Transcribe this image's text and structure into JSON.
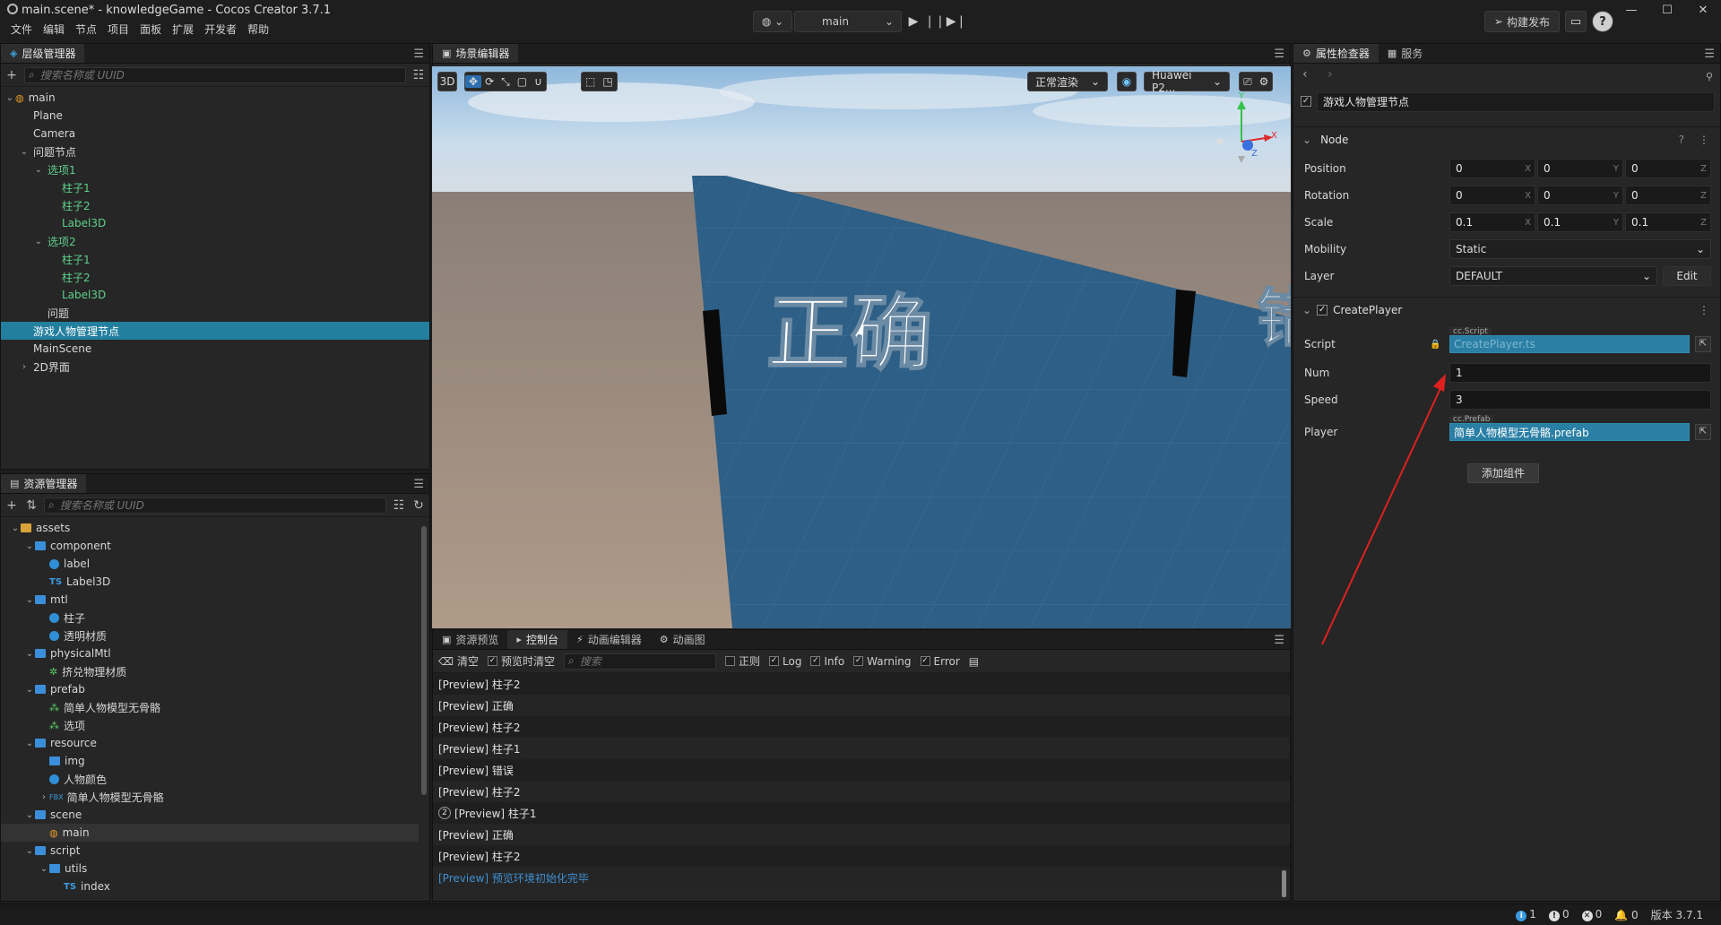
{
  "window": {
    "title": "main.scene* - knowledgeGame - Cocos Creator 3.7.1",
    "menu": [
      "文件",
      "编辑",
      "节点",
      "项目",
      "面板",
      "扩展",
      "开发者",
      "帮助"
    ],
    "scene_select": "main",
    "build_label": "构建发布",
    "help": "?"
  },
  "hierarchy": {
    "tab": "层级管理器",
    "search_placeholder": "搜索名称或 UUID",
    "nodes": [
      {
        "label": "main",
        "depth": 0,
        "arrow": "v",
        "icon": "scene"
      },
      {
        "label": "Plane",
        "depth": 1
      },
      {
        "label": "Camera",
        "depth": 1
      },
      {
        "label": "问题节点",
        "depth": 1,
        "arrow": "v"
      },
      {
        "label": "选项1",
        "depth": 2,
        "arrow": "v",
        "green": true
      },
      {
        "label": "柱子1",
        "depth": 3,
        "green": true
      },
      {
        "label": "柱子2",
        "depth": 3,
        "green": true
      },
      {
        "label": "Label3D",
        "depth": 3,
        "green": true
      },
      {
        "label": "选项2",
        "depth": 2,
        "arrow": "v",
        "green": true
      },
      {
        "label": "柱子1",
        "depth": 3,
        "green": true
      },
      {
        "label": "柱子2",
        "depth": 3,
        "green": true
      },
      {
        "label": "Label3D",
        "depth": 3,
        "green": true
      },
      {
        "label": "问题",
        "depth": 2
      },
      {
        "label": "游戏人物管理节点",
        "depth": 1,
        "selected": true
      },
      {
        "label": "MainScene",
        "depth": 1
      },
      {
        "label": "2D界面",
        "depth": 1,
        "arrow": ">"
      }
    ]
  },
  "assets": {
    "tab": "资源管理器",
    "search_placeholder": "搜索名称或 UUID",
    "items": [
      {
        "label": "assets",
        "depth": 0,
        "arrow": "v",
        "icon": "db"
      },
      {
        "label": "component",
        "depth": 1,
        "arrow": "v",
        "icon": "folder"
      },
      {
        "label": "label",
        "depth": 2,
        "icon": "globe"
      },
      {
        "label": "Label3D",
        "depth": 2,
        "icon": "ts"
      },
      {
        "label": "mtl",
        "depth": 1,
        "arrow": "v",
        "icon": "folder"
      },
      {
        "label": "柱子",
        "depth": 2,
        "icon": "globe"
      },
      {
        "label": "透明材质",
        "depth": 2,
        "icon": "globe"
      },
      {
        "label": "physicalMtl",
        "depth": 1,
        "arrow": "v",
        "icon": "folder"
      },
      {
        "label": "挤兑物理材质",
        "depth": 2,
        "icon": "physic"
      },
      {
        "label": "prefab",
        "depth": 1,
        "arrow": "v",
        "icon": "folder"
      },
      {
        "label": "简单人物模型无骨骼",
        "depth": 2,
        "icon": "prefab"
      },
      {
        "label": "选项",
        "depth": 2,
        "icon": "prefab"
      },
      {
        "label": "resource",
        "depth": 1,
        "arrow": "v",
        "icon": "folder"
      },
      {
        "label": "img",
        "depth": 2,
        "icon": "folder"
      },
      {
        "label": "人物颜色",
        "depth": 2,
        "icon": "globe"
      },
      {
        "label": "简单人物模型无骨骼",
        "depth": 2,
        "arrow": ">",
        "icon": "fbx"
      },
      {
        "label": "scene",
        "depth": 1,
        "arrow": "v",
        "icon": "folder"
      },
      {
        "label": "main",
        "depth": 2,
        "icon": "scene",
        "hl": true
      },
      {
        "label": "script",
        "depth": 1,
        "arrow": "v",
        "icon": "folder"
      },
      {
        "label": "utils",
        "depth": 2,
        "arrow": "v",
        "icon": "folder"
      },
      {
        "label": "index",
        "depth": 3,
        "icon": "ts"
      }
    ]
  },
  "scene_editor": {
    "tab": "场景编辑器",
    "mode_3d": "3D",
    "render_mode": "正常渲染",
    "device": "Huawei P2...",
    "text_correct": "正确",
    "text_partial": "错"
  },
  "console": {
    "tabs": [
      "资源预览",
      "控制台",
      "动画编辑器",
      "动画图"
    ],
    "active_tab": 1,
    "clear": "清空",
    "clear_on_preview": "预览时清空",
    "search_placeholder": "搜索",
    "regex": "正则",
    "filters": [
      "Log",
      "Info",
      "Warning",
      "Error"
    ],
    "logs": [
      {
        "text": "[Preview] 柱子2"
      },
      {
        "text": "[Preview] 正确"
      },
      {
        "text": "[Preview] 柱子2"
      },
      {
        "text": "[Preview] 柱子1"
      },
      {
        "text": "[Preview] 错误"
      },
      {
        "text": "[Preview] 柱子2"
      },
      {
        "text": "[Preview] 柱子1",
        "count": "2"
      },
      {
        "text": "[Preview] 正确"
      },
      {
        "text": "[Preview] 柱子2"
      },
      {
        "text": "[Preview] 预览环境初始化完毕",
        "info": true
      }
    ]
  },
  "inspector": {
    "tabs": [
      "属性检查器",
      "服务"
    ],
    "node_name": "游戏人物管理节点",
    "node_section": "Node",
    "position": {
      "label": "Position",
      "x": "0",
      "y": "0",
      "z": "0"
    },
    "rotation": {
      "label": "Rotation",
      "x": "0",
      "y": "0",
      "z": "0"
    },
    "scale": {
      "label": "Scale",
      "x": "0.1",
      "y": "0.1",
      "z": "0.1"
    },
    "mobility": {
      "label": "Mobility",
      "value": "Static"
    },
    "layer": {
      "label": "Layer",
      "value": "DEFAULT",
      "edit": "Edit"
    },
    "component": "CreatePlayer",
    "script": {
      "label": "Script",
      "tag": "cc.Script",
      "value": "CreatePlayer.ts"
    },
    "num": {
      "label": "Num",
      "value": "1"
    },
    "speed": {
      "label": "Speed",
      "value": "3"
    },
    "player": {
      "label": "Player",
      "tag": "cc.Prefab",
      "value": "简单人物模型无骨骼.prefab"
    },
    "add_component": "添加组件"
  },
  "status": {
    "info_count": "1",
    "warn_count": "0",
    "error_count": "0",
    "notif_count": "0",
    "version": "版本 3.7.1"
  },
  "colors": {
    "accent": "#227f9e",
    "green_node": "#5fd08a",
    "arrow_red": "#e02020"
  }
}
